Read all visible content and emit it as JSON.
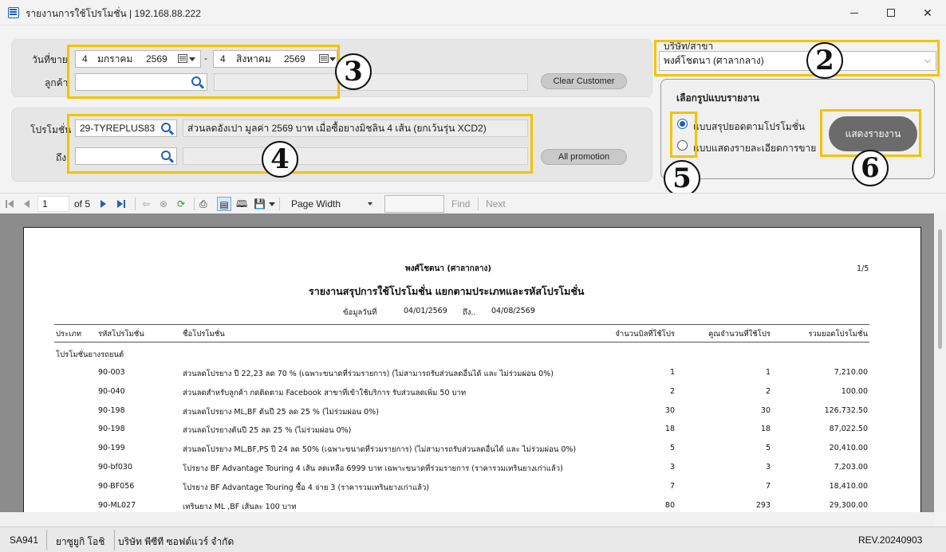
{
  "window": {
    "title": "รายงานการใช้โปรโมชั่น | 192.168.88.222"
  },
  "filters": {
    "sale_date_label": "วันที่ขาย",
    "date_from": {
      "day": "4",
      "month": "มกราคม",
      "year": "2569"
    },
    "date_sep": "-",
    "date_to": {
      "day": "4",
      "month": "สิงหาคม",
      "year": "2569"
    },
    "customer_label": "ลูกค้า",
    "customer_value": "",
    "customer_name": "",
    "clear_customer_label": "Clear Customer",
    "promotion_label": "โปรโมชั่น",
    "promotion_from_code": "29-TYREPLUS83",
    "promotion_from_desc": "ส่วนลดอังเปา มูลค่า 2569 บาท เมื่อซื้อยางมิชลิน 4 เส้น (ยกเว้นรุ่น XCD2)",
    "to_label": "ถึง",
    "promotion_to_code": "",
    "promotion_to_desc": "",
    "all_promotion_label": "All promotion"
  },
  "branch": {
    "label": "บริษัท/สาขา",
    "value": "พงศ์โชตนา (ศาลากลาง)"
  },
  "report_format": {
    "title": "เลือกรูปแบบรายงาน",
    "option_summary": "แบบสรุปยอดตามโปรโมชั่น",
    "option_detail": "แบบแสดงรายละเอียดการขาย",
    "selected": "summary",
    "show_button": "แสดงรายงาน"
  },
  "annotations": {
    "b2": "2",
    "b3": "3",
    "b4": "4",
    "b5": "5",
    "b6": "6"
  },
  "toolbar": {
    "page": "1",
    "of_pages": "of 5",
    "zoom": "Page Width",
    "find_value": "",
    "find_label": "Find",
    "next_label": "Next"
  },
  "report": {
    "company": "พงศ์โชตนา (ศาลากลาง)",
    "page_indicator": "1/5",
    "title": "รายงานสรุปการใช้โปรโมชั่น แยกตามประเภทและรหัสโปรโมชั่น",
    "date_label": "ข้อมูลวันที่",
    "date_from": "04/01/2569",
    "date_to_label": "ถึง..",
    "date_to": "04/08/2569",
    "columns": [
      "ประเภท",
      "รหัสโปรโมชั่น",
      "ชื่อโปรโมชั่น",
      "จำนวนบิลที่ใช้โปร",
      "คูณจำนวนที่ใช้โปร",
      "รวมยอดโปรโมชั่น"
    ],
    "group": "โปรโมชั่นยางรถยนต์",
    "rows": [
      {
        "code": "90-003",
        "name": "ส่วนลดโปรยาง ปี 22,23 ลด 70 % (เฉพาะขนาดที่ร่วมรายการ) (ไม่สามารถรับส่วนลดอื่นได้ และ ไม่ร่วมผ่อน 0%)",
        "bills": "1",
        "qty": "1",
        "total": "7,210.00"
      },
      {
        "code": "90-040",
        "name": "ส่วนลดสำหรับลูกค้า กดติดตาม Facebook สาขาที่เข้าใช้บริการ รับส่วนลดเพิ่ม 50 บาท",
        "bills": "2",
        "qty": "2",
        "total": "100.00"
      },
      {
        "code": "90-198",
        "name": "ส่วนลดโปรยาง ML,BF ต้นปี 25  ลด 25 % (ไม่ร่วมผ่อน 0%)",
        "bills": "30",
        "qty": "30",
        "total": "126,732.50"
      },
      {
        "code": "90-198",
        "name": "ส่วนลดโปรยางต้นปี 25  ลด 25 % (ไม่ร่วมผ่อน 0%)",
        "bills": "18",
        "qty": "18",
        "total": "87,022.50"
      },
      {
        "code": "90-199",
        "name": "ส่วนลดโปรยาง ML,BF,PS ปี 24 ลด 50% (เฉพาะขนาดที่ร่วมรายการ) (ไม่สามารถรับส่วนลดอื่นได้ และ ไม่ร่วมผ่อน 0%)",
        "bills": "5",
        "qty": "5",
        "total": "20,410.00"
      },
      {
        "code": "90-bf030",
        "name": "โปรยาง BF Advantage Touring 4 เส้น ลดเหลือ  6999 บาท เฉพาะขนาดที่ร่วมรายการ (ราคารวมเทรินยางเก่าแล้ว)",
        "bills": "3",
        "qty": "3",
        "total": "7,203.00"
      },
      {
        "code": "90-BF056",
        "name": "โปรยาง BF Advantage Touring ซื้อ 4 จ่าย 3  (ราคารวมเทรินยางเก่าแล้ว)",
        "bills": "7",
        "qty": "7",
        "total": "18,410.00"
      },
      {
        "code": "90-ML027",
        "name": "เทรินยาง  ML ,BF เส้นละ 100 บาท",
        "bills": "80",
        "qty": "293",
        "total": "29,300.00"
      }
    ]
  },
  "status": {
    "user_code": "SA941",
    "user_name": "ยาซูยูกิ  โอชิ",
    "company": "บริษัท พีซีที ซอฟต์แวร์ จำกัด",
    "revision": "REV.20240903"
  }
}
